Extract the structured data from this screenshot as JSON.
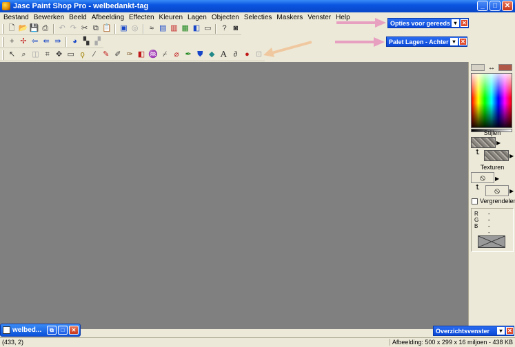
{
  "window": {
    "title": "Jasc Paint Shop Pro - welbedankt-tag",
    "controls": {
      "minimize": "_",
      "maximize": "□",
      "close": "✕"
    }
  },
  "menu": [
    "Bestand",
    "Bewerken",
    "Beeld",
    "Afbeelding",
    "Effecten",
    "Kleuren",
    "Lagen",
    "Objecten",
    "Selecties",
    "Maskers",
    "Venster",
    "Help"
  ],
  "toolbars": {
    "standard": [
      "new-icon",
      "open-icon",
      "save-icon",
      "print-icon",
      "undo-icon",
      "redo-icon",
      "cut-icon",
      "copy-icon",
      "paste-icon",
      "browse-icon",
      "full-screen-icon",
      "histogram-icon",
      "color-adjust-icon",
      "layers-icon",
      "overview-icon",
      "rulers-icon",
      "help-icon",
      "camera-icon"
    ],
    "web": [
      "move-icon",
      "pan-icon",
      "arrow-left-icon",
      "arrow-back-icon",
      "arrow-forward-icon",
      "web-icon",
      "image-slicer-icon",
      "image-mapper-icon"
    ],
    "tools": [
      "selection-arrow-icon",
      "zoom-icon",
      "deform-icon",
      "crop-icon",
      "mover-icon",
      "rect-selection-icon",
      "lasso-icon",
      "eyedropper-icon",
      "paintbrush-icon",
      "clone-brush-icon",
      "color-replacer-icon",
      "retouch-icon",
      "scratch-remover-icon",
      "eraser-icon",
      "picture-tube-icon",
      "airbrush-icon",
      "flood-fill-icon",
      "text-icon",
      "draw-icon",
      "preset-shapes-icon",
      "object-selector-icon"
    ]
  },
  "palettes": {
    "tool_options": {
      "title": "Opties voor gereedsc"
    },
    "layers": {
      "title": "Palet Lagen - Achterg"
    },
    "overview": {
      "title": "Overzichtsvenster"
    }
  },
  "color_palette": {
    "swap_glyph": "↔",
    "styles_label": "Stijlen",
    "textures_label": "Texturen",
    "lock_label": "Vergrendelen",
    "lock_checked": false,
    "rgb": [
      {
        "channel": "R",
        "value": "--"
      },
      {
        "channel": "G",
        "value": "--"
      },
      {
        "channel": "B",
        "value": "--"
      }
    ],
    "foreground_color": "#d6d2c6",
    "background_color": "#b05848"
  },
  "task_button": {
    "label": "welbed..."
  },
  "status": {
    "coords": "(433, 2)",
    "image_info": "Afbeelding: 500 x 299 x 16 miljoen - 438 KB"
  },
  "colors": {
    "canvas_bg": "#808080",
    "arrow_pink": "#e8a0c0",
    "arrow_peach": "#f0c8a0",
    "arrow_orange": "#f08830"
  }
}
